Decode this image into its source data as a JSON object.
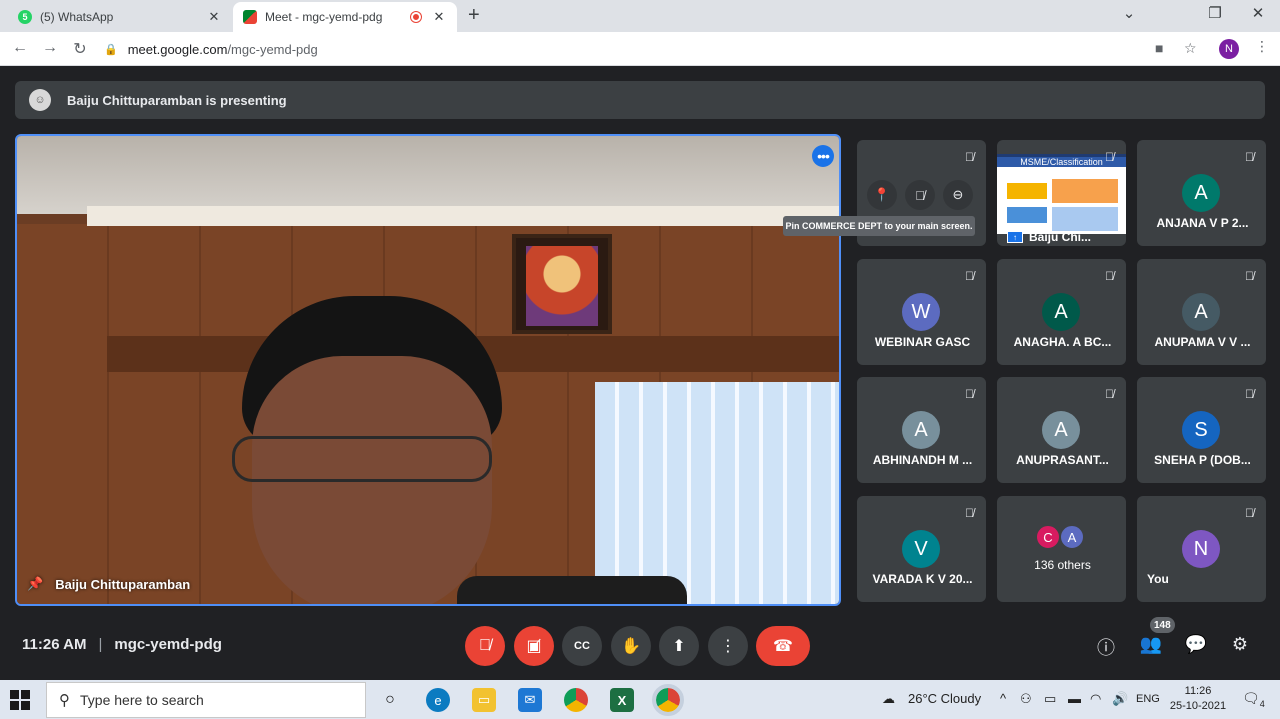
{
  "browser": {
    "tabs": [
      {
        "title": "(5) WhatsApp",
        "badge": "5"
      },
      {
        "title": "Meet - mgc-yemd-pdg"
      }
    ],
    "url_domain": "meet.google.com",
    "url_path": "/mgc-yemd-pdg",
    "profile_initial": "N"
  },
  "banner": {
    "text": "Baiju Chittuparamban is presenting"
  },
  "main_video": {
    "name": "Baiju Chittuparamban"
  },
  "tooltip": "Pin COMMERCE DEPT to your main screen.",
  "tiles": [
    {
      "name": "ANJANA V P 2...",
      "initial": "A",
      "color": "#00796b"
    },
    {
      "name": "WEBINAR GASC",
      "initial": "W",
      "color": "#5c6bc0"
    },
    {
      "name": "ANAGHA. A BC...",
      "initial": "A",
      "color": "#00594a"
    },
    {
      "name": "ANUPAMA V V ...",
      "initial": "A",
      "color": "#455a64"
    },
    {
      "name": "ABHINANDH M ...",
      "initial": "A",
      "color": "#78909c"
    },
    {
      "name": "ANUPRASANT...",
      "initial": "A",
      "color": "#78909c"
    },
    {
      "name": "SNEHA P (DOB...",
      "initial": "S",
      "color": "#1565c0"
    },
    {
      "name": "VARADA K V 20...",
      "initial": "V",
      "color": "#00838f"
    },
    {
      "name": "You",
      "initial": "N",
      "color": "#7e57c2"
    }
  ],
  "slide_tile": {
    "title": "MSME/Classification",
    "name": "Baiju Chi..."
  },
  "others": {
    "label": "136 others",
    "avatars": [
      {
        "initial": "C",
        "color": "#d81b60"
      },
      {
        "initial": "A",
        "color": "#5c6bc0"
      }
    ]
  },
  "bottom": {
    "time": "11:26 AM",
    "meeting_code": "mgc-yemd-pdg",
    "participant_count": "148"
  },
  "taskbar": {
    "search_placeholder": "Type here to search",
    "weather": "26°C  Cloudy",
    "lang": "ENG",
    "time": "11:26",
    "date": "25-10-2021",
    "notification_count": "4"
  }
}
